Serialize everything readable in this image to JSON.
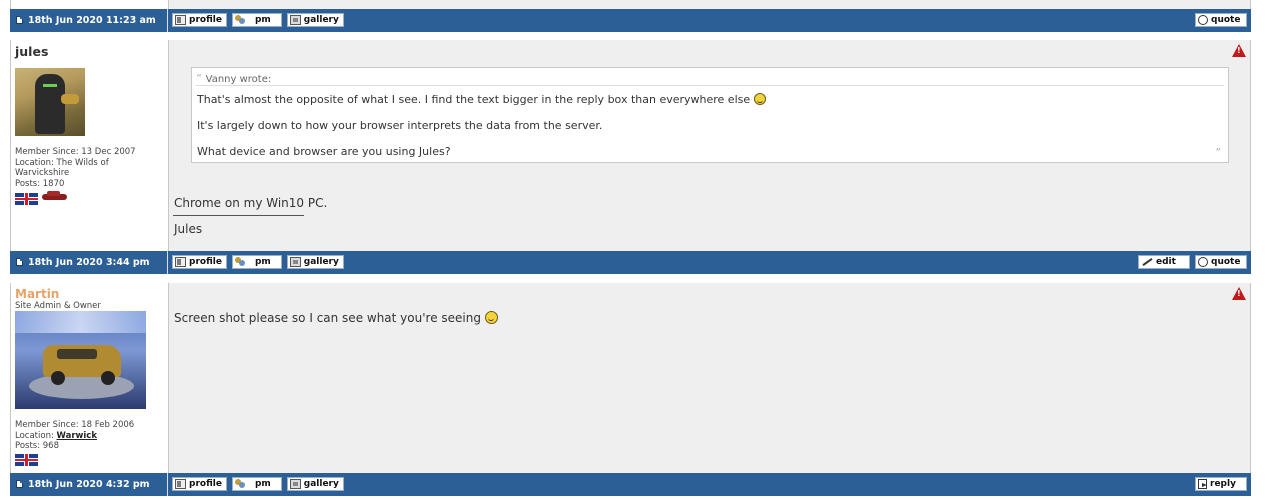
{
  "posts": [
    {
      "date": "18th Jun 2020 11:23 am",
      "buttons": [
        "profile",
        "pm",
        "gallery"
      ],
      "actions": [
        "quote"
      ]
    },
    {
      "author": "jules",
      "member_since": "Member Since: 13 Dec 2007",
      "location_label": "Location: ",
      "location": "The Wilds of Warvickshire",
      "posts": "Posts: 1870",
      "quote_author": "Vanny wrote:",
      "quote_lines": [
        "That's almost the opposite of what I see. I find the text bigger in the reply box than everywhere else",
        "It's largely down to how your browser interprets the data from the server.",
        "What device and browser are you using Jules?"
      ],
      "body": "Chrome on my Win10 PC.",
      "signature": "Jules",
      "date": "18th Jun 2020 3:44 pm",
      "buttons": [
        "profile",
        "pm",
        "gallery"
      ],
      "actions": [
        "edit",
        "quote"
      ]
    },
    {
      "author": "Martin",
      "role": "Site Admin & Owner",
      "member_since": "Member Since: 18 Feb 2006",
      "location_label": "Location: ",
      "location": "Warwick",
      "posts": "Posts: 968",
      "body": "Screen shot please so I can see what you're seeing",
      "date": "18th Jun 2020 4:32 pm",
      "buttons": [
        "profile",
        "pm",
        "gallery"
      ],
      "actions": [
        "reply"
      ]
    }
  ],
  "colors": {
    "bar": "#2c5f96",
    "admin_name": "#e8a36a",
    "warn": "#c21a1a"
  }
}
